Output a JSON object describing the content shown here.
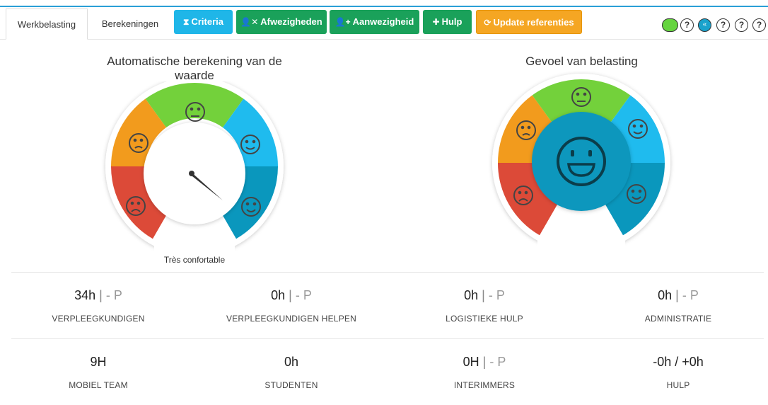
{
  "tabs": [
    {
      "label": "Werkbelasting",
      "active": true
    },
    {
      "label": "Berekeningen",
      "active": false
    }
  ],
  "toolbar": {
    "criteria": {
      "label": "Criteria",
      "icon": "hourglass-icon"
    },
    "afwezigheden": {
      "label": "Afwezigheden",
      "icon": "user-remove-icon"
    },
    "aanwezigheid": {
      "label": "Aanwezigheid",
      "icon": "user-add-icon"
    },
    "hulp": {
      "label": "Hulp",
      "icon": "medkit-icon"
    },
    "update": {
      "label": "Update referenties",
      "icon": "refresh-icon"
    }
  },
  "controls": {
    "status_color": "#65d43f",
    "help_glyph": "?",
    "collapse_glyph": "«"
  },
  "gauge_auto": {
    "title": "Automatische berekening van de waarde",
    "caption": "Très confortable",
    "colors": [
      "#dc4a38",
      "#f29b1d",
      "#73d13b",
      "#1fbbee",
      "#0a97bd"
    ]
  },
  "gauge_feel": {
    "title": "Gevoel van belasting",
    "colors": [
      "#dc4a38",
      "#f29b1d",
      "#73d13b",
      "#1fbbee",
      "#0a97bd"
    ],
    "center_color": "#0a97bd"
  },
  "stats_row1": [
    {
      "value": "34h",
      "sep": "|",
      "extra": "- P",
      "label": "VERPLEEGKUNDIGEN"
    },
    {
      "value": "0h",
      "sep": "|",
      "extra": "- P",
      "label": "VERPLEEGKUNDIGEN HELPEN"
    },
    {
      "value": "0h",
      "sep": "|",
      "extra": "- P",
      "label": "LOGISTIEKE HULP"
    },
    {
      "value": "0h",
      "sep": "|",
      "extra": "- P",
      "label": "ADMINISTRATIE"
    }
  ],
  "stats_row2": [
    {
      "value": "9H",
      "label": "MOBIEL TEAM"
    },
    {
      "value": "0h",
      "label": "STUDENTEN"
    },
    {
      "value": "0H",
      "sep": "|",
      "extra": "- P",
      "label": "INTERIMMERS"
    },
    {
      "value": "-0h / +0h",
      "label": "HULP"
    }
  ]
}
